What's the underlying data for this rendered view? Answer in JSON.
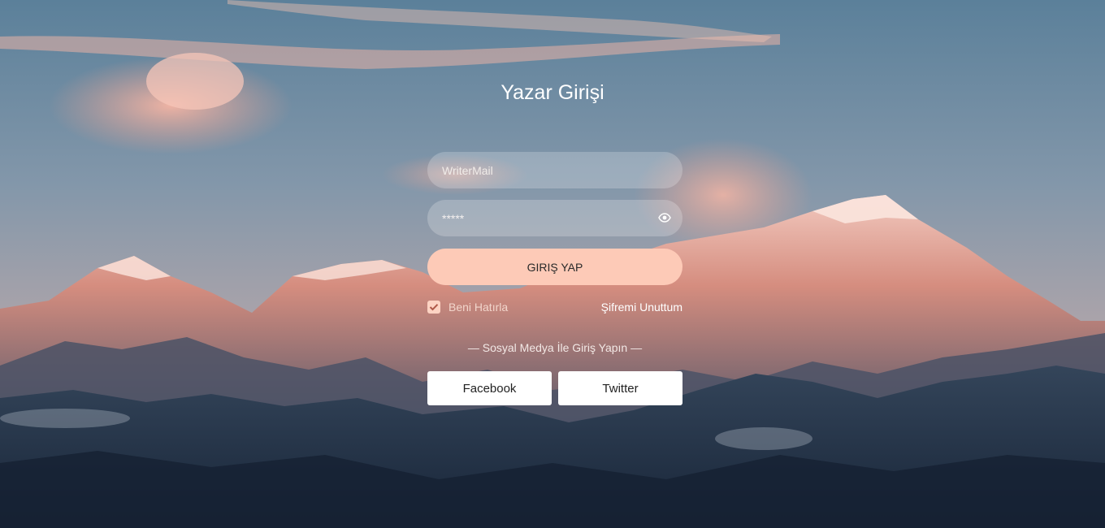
{
  "login": {
    "title": "Yazar Girişi",
    "email": {
      "placeholder": "WriterMail",
      "value": ""
    },
    "password": {
      "value": "*****",
      "toggle_icon": "eye-icon"
    },
    "submit_label": "GIRIŞ YAP",
    "remember_label": "Beni Hatırla",
    "remember_checked": true,
    "forgot_label": "Şifremi Unuttum"
  },
  "social": {
    "title": "— Sosyal Medya İle Giriş Yapın —",
    "facebook_label": "Facebook",
    "twitter_label": "Twitter"
  },
  "colors": {
    "accent": "#fdcab7",
    "button_white": "#ffffff"
  }
}
